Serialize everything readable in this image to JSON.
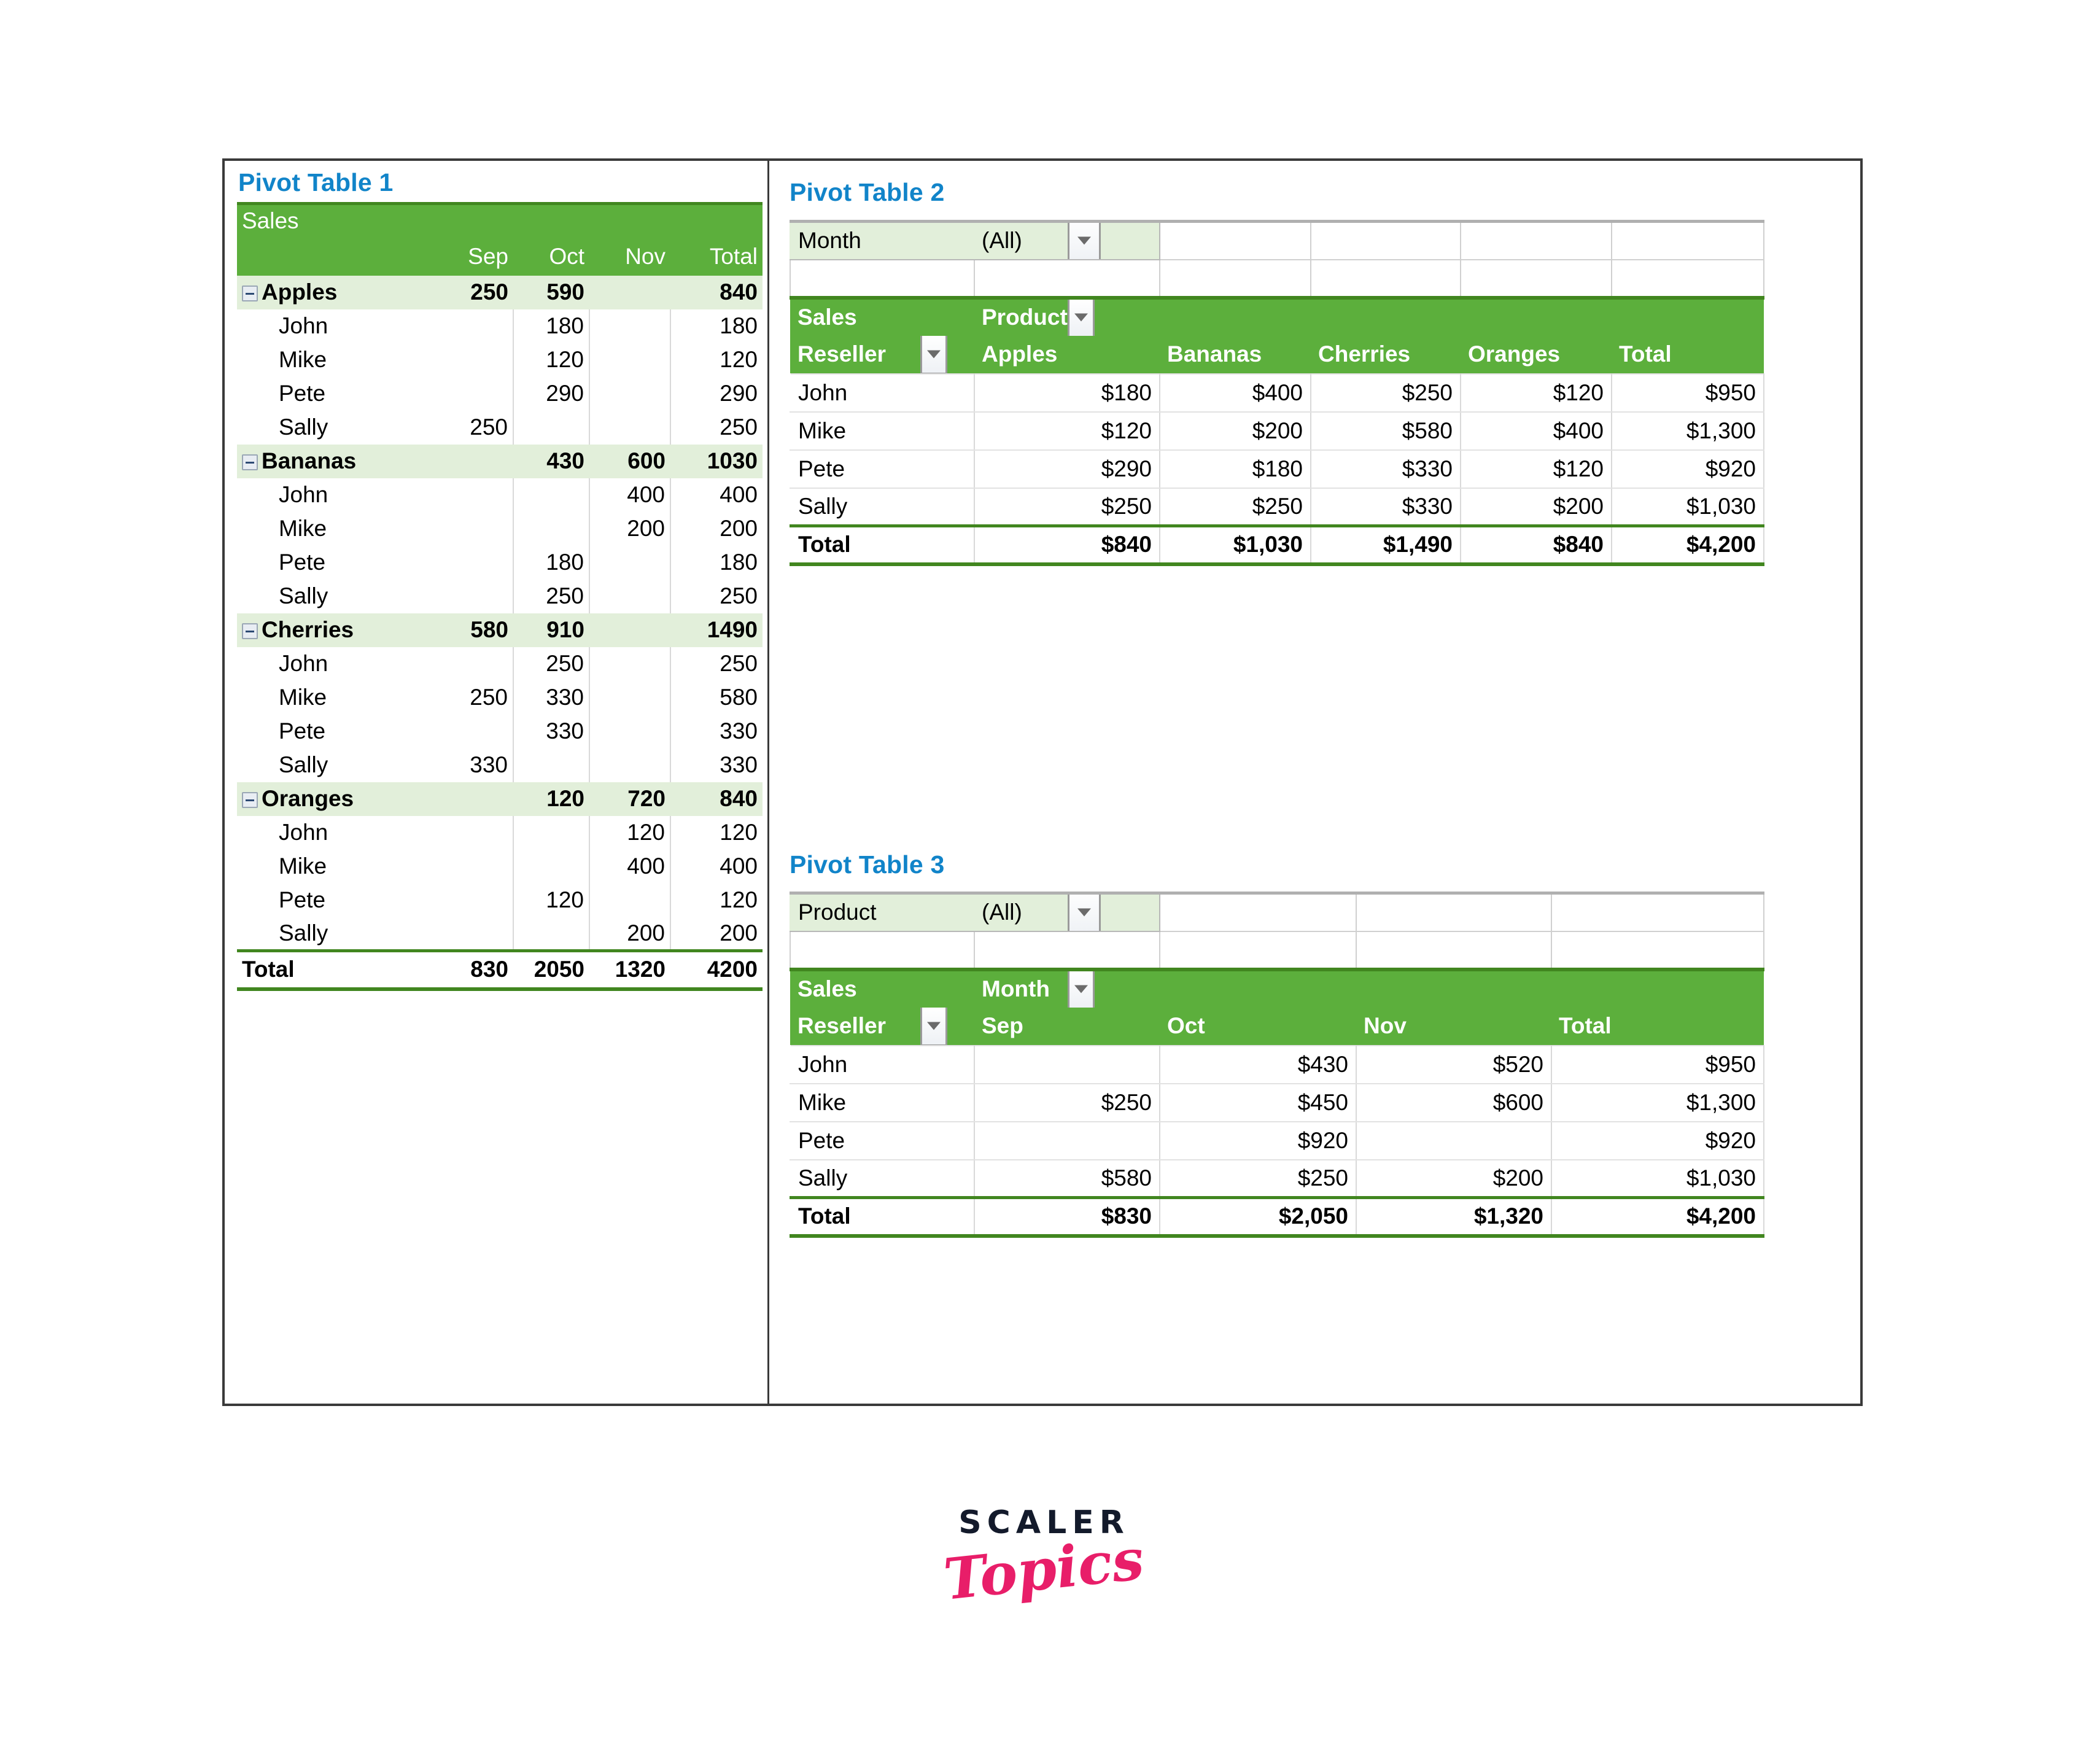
{
  "colors": {
    "title_blue": "#1184C9",
    "header_green": "#5CAF3C",
    "header_green_dark": "#41861F",
    "group_row_green": "#E2EFDA",
    "logo_dark": "#131a2b",
    "logo_pink": "#E81E69"
  },
  "pivot1": {
    "title": "Pivot Table 1",
    "value_field": "Sales",
    "columns": [
      "Sep",
      "Oct",
      "Nov",
      "Total"
    ],
    "rows": [
      {
        "type": "group",
        "label": "Apples",
        "values": [
          "250",
          "590",
          "",
          "840"
        ]
      },
      {
        "type": "sub",
        "label": "John",
        "values": [
          "",
          "180",
          "",
          "180"
        ]
      },
      {
        "type": "sub",
        "label": "Mike",
        "values": [
          "",
          "120",
          "",
          "120"
        ]
      },
      {
        "type": "sub",
        "label": "Pete",
        "values": [
          "",
          "290",
          "",
          "290"
        ]
      },
      {
        "type": "sub",
        "label": "Sally",
        "values": [
          "250",
          "",
          "",
          "250"
        ]
      },
      {
        "type": "group",
        "label": "Bananas",
        "values": [
          "",
          "430",
          "600",
          "1030"
        ]
      },
      {
        "type": "sub",
        "label": "John",
        "values": [
          "",
          "",
          "400",
          "400"
        ]
      },
      {
        "type": "sub",
        "label": "Mike",
        "values": [
          "",
          "",
          "200",
          "200"
        ]
      },
      {
        "type": "sub",
        "label": "Pete",
        "values": [
          "",
          "180",
          "",
          "180"
        ]
      },
      {
        "type": "sub",
        "label": "Sally",
        "values": [
          "",
          "250",
          "",
          "250"
        ]
      },
      {
        "type": "group",
        "label": "Cherries",
        "values": [
          "580",
          "910",
          "",
          "1490"
        ]
      },
      {
        "type": "sub",
        "label": "John",
        "values": [
          "",
          "250",
          "",
          "250"
        ]
      },
      {
        "type": "sub",
        "label": "Mike",
        "values": [
          "250",
          "330",
          "",
          "580"
        ]
      },
      {
        "type": "sub",
        "label": "Pete",
        "values": [
          "",
          "330",
          "",
          "330"
        ]
      },
      {
        "type": "sub",
        "label": "Sally",
        "values": [
          "330",
          "",
          "",
          "330"
        ]
      },
      {
        "type": "group",
        "label": "Oranges",
        "values": [
          "",
          "120",
          "720",
          "840"
        ]
      },
      {
        "type": "sub",
        "label": "John",
        "values": [
          "",
          "",
          "120",
          "120"
        ]
      },
      {
        "type": "sub",
        "label": "Mike",
        "values": [
          "",
          "",
          "400",
          "400"
        ]
      },
      {
        "type": "sub",
        "label": "Pete",
        "values": [
          "",
          "120",
          "",
          "120"
        ]
      },
      {
        "type": "sub",
        "label": "Sally",
        "values": [
          "",
          "",
          "200",
          "200"
        ]
      }
    ],
    "total": {
      "label": "Total",
      "values": [
        "830",
        "2050",
        "1320",
        "4200"
      ]
    }
  },
  "pivot2": {
    "title": "Pivot Table 2",
    "filter": {
      "field": "Month",
      "value": "(All)"
    },
    "value_field": "Sales",
    "column_field": "Product",
    "row_field": "Reseller",
    "columns": [
      "Apples",
      "Bananas",
      "Cherries",
      "Oranges",
      "Total"
    ],
    "rows": [
      {
        "label": "John",
        "values": [
          "$180",
          "$400",
          "$250",
          "$120",
          "$950"
        ]
      },
      {
        "label": "Mike",
        "values": [
          "$120",
          "$200",
          "$580",
          "$400",
          "$1,300"
        ]
      },
      {
        "label": "Pete",
        "values": [
          "$290",
          "$180",
          "$330",
          "$120",
          "$920"
        ]
      },
      {
        "label": "Sally",
        "values": [
          "$250",
          "$250",
          "$330",
          "$200",
          "$1,030"
        ]
      }
    ],
    "total": {
      "label": "Total",
      "values": [
        "$840",
        "$1,030",
        "$1,490",
        "$840",
        "$4,200"
      ]
    }
  },
  "pivot3": {
    "title": "Pivot Table 3",
    "filter": {
      "field": "Product",
      "value": "(All)"
    },
    "value_field": "Sales",
    "column_field": "Month",
    "row_field": "Reseller",
    "columns": [
      "Sep",
      "Oct",
      "Nov",
      "Total"
    ],
    "rows": [
      {
        "label": "John",
        "values": [
          "",
          "$430",
          "$520",
          "$950"
        ]
      },
      {
        "label": "Mike",
        "values": [
          "$250",
          "$450",
          "$600",
          "$1,300"
        ]
      },
      {
        "label": "Pete",
        "values": [
          "",
          "$920",
          "",
          "$920"
        ]
      },
      {
        "label": "Sally",
        "values": [
          "$580",
          "$250",
          "$200",
          "$1,030"
        ]
      }
    ],
    "total": {
      "label": "Total",
      "values": [
        "$830",
        "$2,050",
        "$1,320",
        "$4,200"
      ]
    }
  },
  "logo": {
    "top": "SCALER",
    "bottom": "Topics"
  }
}
